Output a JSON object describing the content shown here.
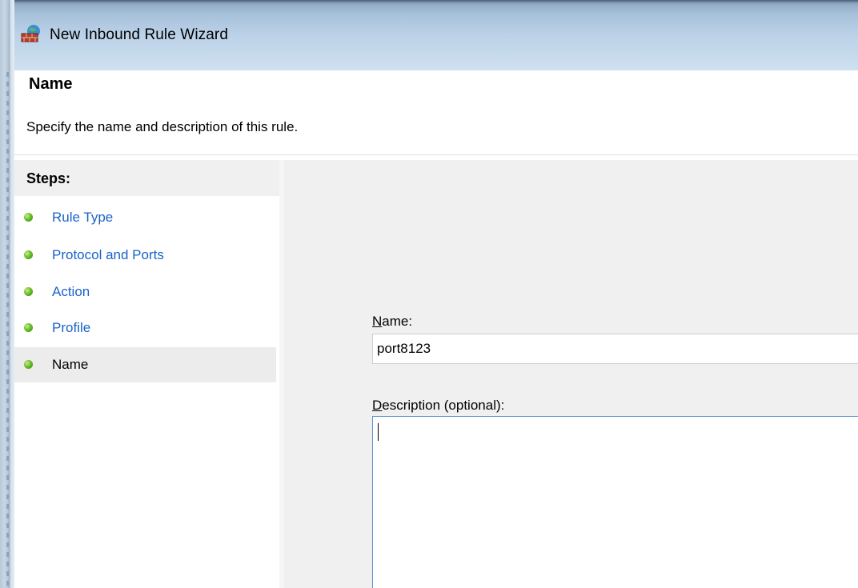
{
  "window": {
    "title": "New Inbound Rule Wizard",
    "icon": "firewall-icon"
  },
  "header": {
    "title": "Name",
    "subtitle": "Specify the name and description of this rule."
  },
  "steps": {
    "heading": "Steps:",
    "items": [
      {
        "label": "Rule Type",
        "active": false
      },
      {
        "label": "Protocol and Ports",
        "active": false
      },
      {
        "label": "Action",
        "active": false
      },
      {
        "label": "Profile",
        "active": false
      },
      {
        "label": "Name",
        "active": true
      }
    ]
  },
  "form": {
    "name_label_accel": "N",
    "name_label_rest": "ame:",
    "name_value": "port8123",
    "description_label_accel": "D",
    "description_label_rest": "escription (optional):",
    "description_value": ""
  },
  "colors": {
    "link": "#1a63c8",
    "step_bullet": "#6cbf2c",
    "focus_border": "#5e93cc"
  }
}
